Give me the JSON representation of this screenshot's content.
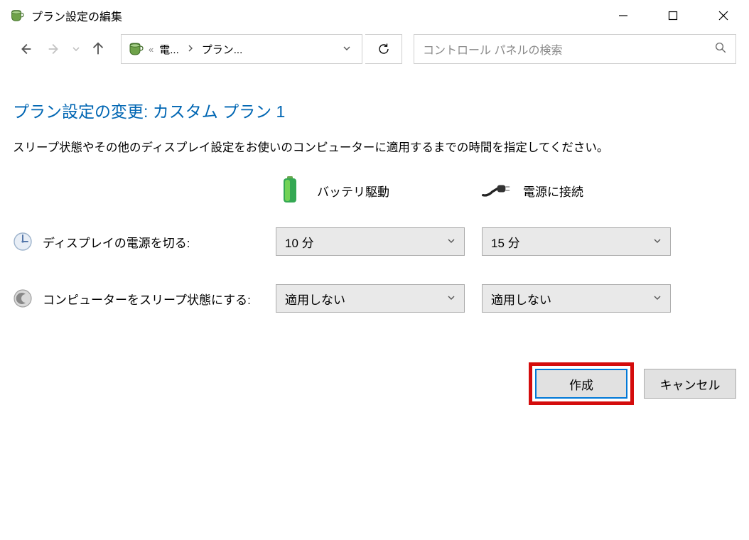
{
  "window": {
    "title": "プラン設定の編集"
  },
  "nav": {
    "crumb1": "電...",
    "crumb2": "プラン...",
    "search_placeholder": "コントロール パネルの検索"
  },
  "page": {
    "heading": "プラン設定の変更: カスタム プラン 1",
    "description": "スリープ状態やその他のディスプレイ設定をお使いのコンピューターに適用するまでの時間を指定してください。"
  },
  "columns": {
    "battery": "バッテリ駆動",
    "plugged": "電源に接続"
  },
  "rows": {
    "display_off": {
      "label": "ディスプレイの電源を切る:",
      "battery_value": "10 分",
      "plugged_value": "15 分"
    },
    "sleep": {
      "label": "コンピューターをスリープ状態にする:",
      "battery_value": "適用しない",
      "plugged_value": "適用しない"
    }
  },
  "buttons": {
    "create": "作成",
    "cancel": "キャンセル"
  }
}
